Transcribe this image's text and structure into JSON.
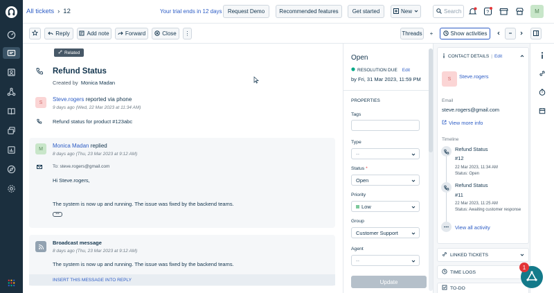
{
  "header": {
    "breadcrumb_link": "All tickets",
    "breadcrumb_sep": "›",
    "ticket_number": "12",
    "trial_text": "Your trial ends in 12 days",
    "request_demo": "Request Demo",
    "recommended": "Recommended features",
    "get_started": "Get started",
    "new_label": "New",
    "search_placeholder": "Search",
    "avatar_initial": "M"
  },
  "toolbar": {
    "reply": "Reply",
    "add_note": "Add note",
    "forward": "Forward",
    "close": "Close",
    "more": "⋮",
    "threads": "Threads",
    "plus": "+",
    "show_activities": "Show activities"
  },
  "ticket": {
    "related_label": "Related",
    "subject": "Refund Status",
    "created_by_prefix": "Created by",
    "created_by": "Monica Madan",
    "messages": [
      {
        "initial": "S",
        "author": "Steve.rogers",
        "action": "reported via phone",
        "time": "9 days ago (Wed, 22 Mar 2023 at 11:34 AM)",
        "text": "Refund status for product #123abc"
      },
      {
        "initial": "M",
        "author": "Monica Madan",
        "action": "replied",
        "time": "8 days ago (Thu, 23 Mar 2023 at 9:12 AM)",
        "to": "To: steve.rogers@gmail.com",
        "greeting": "Hi Steve.rogers,",
        "text": "The system is now up and running. The issue was fixed by the backend teams.",
        "ellipsis": "•••"
      },
      {
        "author": "Broadcast message",
        "time": "8 days ago (Thu, 23 Mar 2023 at 9:12 AM)",
        "text": "The system is now up and running. The issue was fixed by the backend teams.",
        "insert_label": "INSERT THIS MESSAGE INTO REPLY"
      }
    ]
  },
  "properties": {
    "status_title": "Open",
    "resolution_due": "RESOLUTION DUE",
    "edit": "Edit",
    "due_date": "by Fri, 31 Mar 2023, 11:59 PM",
    "section_title": "PROPERTIES",
    "tags_label": "Tags",
    "type_label": "Type",
    "type_value": "--",
    "status_label": "Status",
    "required_mark": "*",
    "status_value": "Open",
    "priority_label": "Priority",
    "priority_value": "Low",
    "group_label": "Group",
    "group_value": "Customer Support",
    "agent_label": "Agent",
    "agent_value": "--",
    "update_button": "Update"
  },
  "contact": {
    "header": "CONTACT DETAILS",
    "header_sep": "|",
    "edit": "Edit",
    "initial": "S",
    "name": "Steve.rogers",
    "email_label": "Email",
    "email": "steve.rogers@gmail.com",
    "view_more": "View more info",
    "timeline_label": "Timeline",
    "timeline": [
      {
        "title": "Refund Status",
        "id": "#12",
        "date": "22 Mar 2023, 11:34 AM",
        "status": "Status: Open"
      },
      {
        "title": "Refund Status",
        "id": "#11",
        "date": "22 Mar 2023, 11:25 AM",
        "status": "Status: Awaiting customer response"
      }
    ],
    "view_all": "View all activity",
    "linked_tickets": "LINKED TICKETS",
    "time_logs": "TIME LOGS",
    "todo": "TO-DO"
  },
  "bot": {
    "badge": "1"
  },
  "colors": {
    "nav_bg": "#1b2f3e",
    "link": "#2c5cc5",
    "accent_green": "#00a886",
    "badge_red": "#e43538"
  }
}
